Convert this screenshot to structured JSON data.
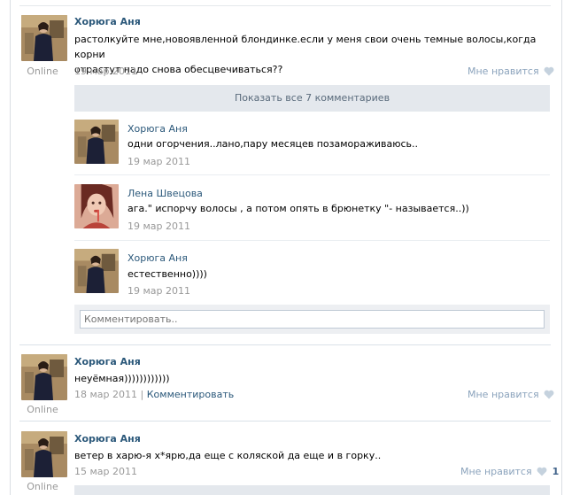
{
  "posts": [
    {
      "author": "Хорюга Аня",
      "status": "Online",
      "text": "растолкуйте мне,новоявленной блондинке.если у меня свои очень темные волосы,когда корни\nотрастут надо снова обесцвечиваться??",
      "date": "19 мар 2011",
      "like_label": "Мне нравится",
      "show_all_label": "Показать все 7 комментариев",
      "replies": [
        {
          "author": "Хорюга Аня",
          "text": "одни огорчения..лано,пару месяцев позамораживаюсь..",
          "date": "19 мар 2011"
        },
        {
          "author": "Лена Швецова",
          "text": "ага.\" испорчу волосы , а потом опять в брюнетку \"- называется..))",
          "date": "19 мар 2011"
        },
        {
          "author": "Хорюга Аня",
          "text": "естественно))))",
          "date": "19 мар 2011"
        }
      ],
      "comment_placeholder": "Комментировать.."
    },
    {
      "author": "Хорюга Аня",
      "status": "Online",
      "text": "неуёмная))))))))))))",
      "date": "18 мар 2011",
      "separator": "|",
      "comment_link": "Комментировать",
      "like_label": "Мне нравится"
    },
    {
      "author": "Хорюга Аня",
      "status": "Online",
      "text": "ветер в харю-я х*ярю,да еще с коляской да еще и в горку..",
      "date": "15 мар 2011",
      "like_label": "Мне нравится",
      "like_count": "1"
    }
  ],
  "icons": {
    "like": "heart-icon"
  },
  "colors": {
    "link": "#2b587a",
    "muted": "#999999",
    "like": "#8ba3bc",
    "panel": "#e4e8ed"
  }
}
